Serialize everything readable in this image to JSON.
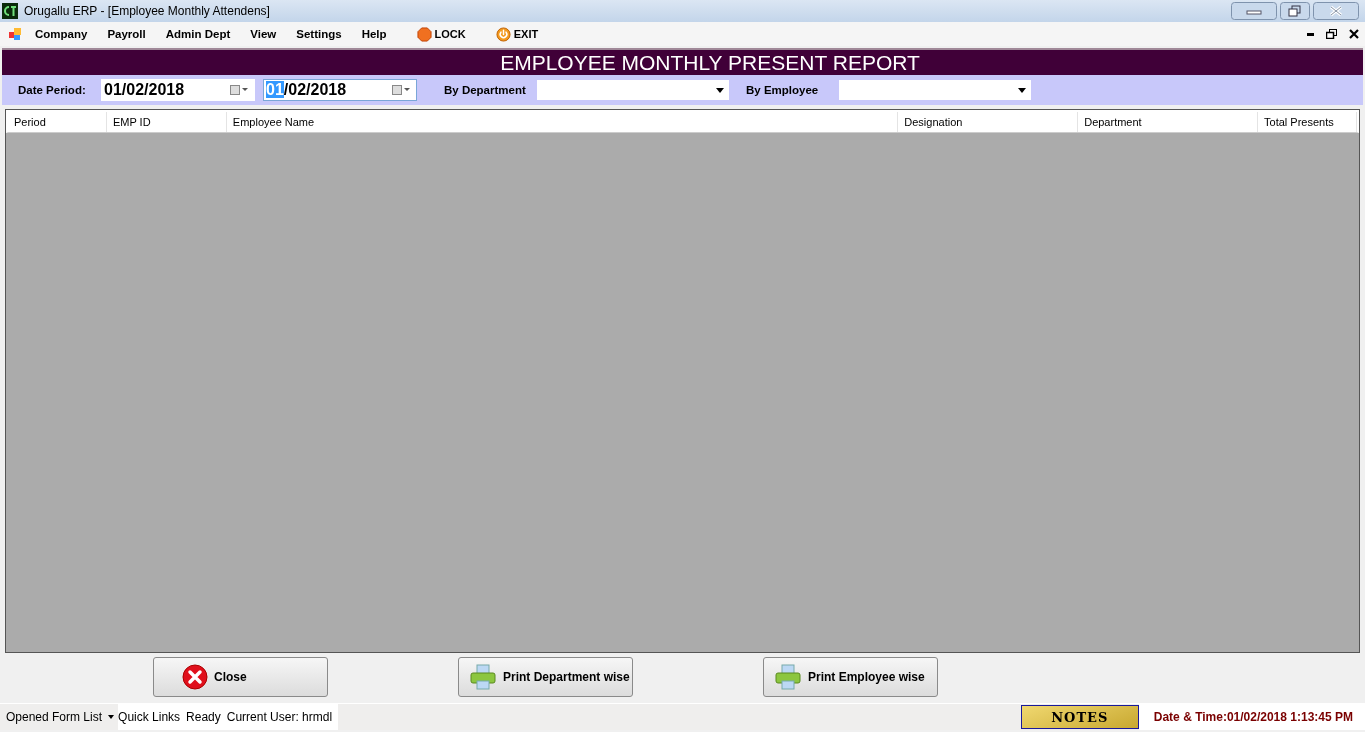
{
  "window": {
    "title": "Orugallu ERP - [Employee Monthly Attendens]"
  },
  "menu": [
    {
      "label": "Company",
      "kind": "menu"
    },
    {
      "label": "Payroll",
      "kind": "menu"
    },
    {
      "label": "Admin Dept",
      "kind": "menu"
    },
    {
      "label": "View",
      "kind": "menu"
    },
    {
      "label": "Settings",
      "kind": "menu"
    },
    {
      "label": "Help",
      "kind": "menu"
    },
    {
      "label": "LOCK",
      "kind": "lock"
    },
    {
      "label": "EXIT",
      "kind": "exit"
    }
  ],
  "report_title": "EMPLOYEE MONTHLY PRESENT REPORT",
  "filters": {
    "date_label": "Date Period:",
    "from_date": {
      "value": "01/02/2018",
      "highlighted": false
    },
    "to_date": {
      "value": "01/02/2018",
      "highlighted": true
    },
    "department_label": "By Department",
    "employee_label": "By Employee"
  },
  "table": {
    "columns": [
      "Period",
      "EMP ID",
      "Employee Name",
      "Designation",
      "Department",
      "Total Presents"
    ]
  },
  "buttons": [
    {
      "label": "Close",
      "kind": "close"
    },
    {
      "label": "Print Department wise",
      "kind": "print"
    },
    {
      "label": "Print Employee wise",
      "kind": "print"
    }
  ],
  "status_bar": {
    "opened_forms": "Opened Form List",
    "quick_links": "Quick Links",
    "status": "Ready",
    "user": "Current User: hrmdl",
    "notes": "NOTES",
    "datetime": "Date & Time:01/02/2018 1:13:45 PM"
  }
}
